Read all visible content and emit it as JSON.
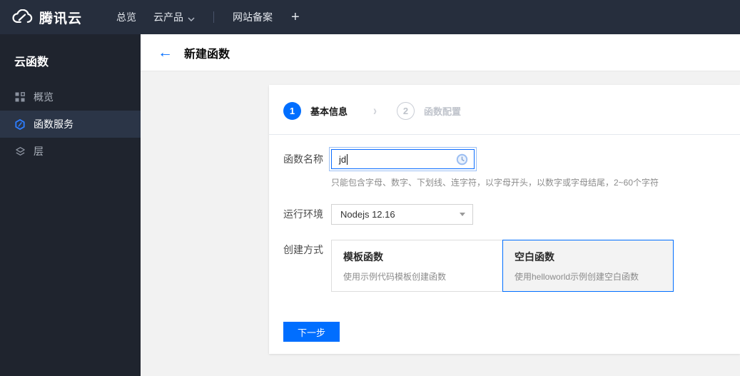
{
  "topbar": {
    "brand": "腾讯云",
    "nav": [
      {
        "label": "总览"
      },
      {
        "label": "云产品"
      },
      {
        "label": "网站备案"
      }
    ],
    "plus_label": "+"
  },
  "sidebar": {
    "title": "云函数",
    "items": [
      {
        "label": "概览",
        "icon": "grid-icon",
        "active": false
      },
      {
        "label": "函数服务",
        "icon": "scf-hexagon-icon",
        "active": true
      },
      {
        "label": "层",
        "icon": "layers-icon",
        "active": false
      }
    ]
  },
  "header": {
    "back_glyph": "←",
    "title": "新建函数"
  },
  "wizard": {
    "steps": [
      {
        "num": "1",
        "label": "基本信息",
        "active": true
      },
      {
        "num": "2",
        "label": "函数配置",
        "active": false
      }
    ],
    "chevron": "›",
    "form": {
      "name": {
        "label": "函数名称",
        "value": "jd",
        "status_icon": "clock-pending-icon",
        "help": "只能包含字母、数字、下划线、连字符，以字母开头，以数字或字母结尾，2~60个字符"
      },
      "runtime": {
        "label": "运行环境",
        "value": "Nodejs 12.16"
      },
      "method": {
        "label": "创建方式",
        "options": [
          {
            "title": "模板函数",
            "desc": "使用示例代码模板创建函数",
            "selected": false
          },
          {
            "title": "空白函数",
            "desc": "使用helloworld示例创建空白函数",
            "selected": true
          }
        ]
      }
    },
    "next_label": "下一步"
  },
  "colors": {
    "accent": "#006eff",
    "topbar_bg": "#262e3d",
    "sidebar_bg": "#1f242e",
    "sidebar_active_bg": "#2b3547",
    "content_bg": "#f2f2f2",
    "selected_card_bg": "#f3f3f3"
  }
}
